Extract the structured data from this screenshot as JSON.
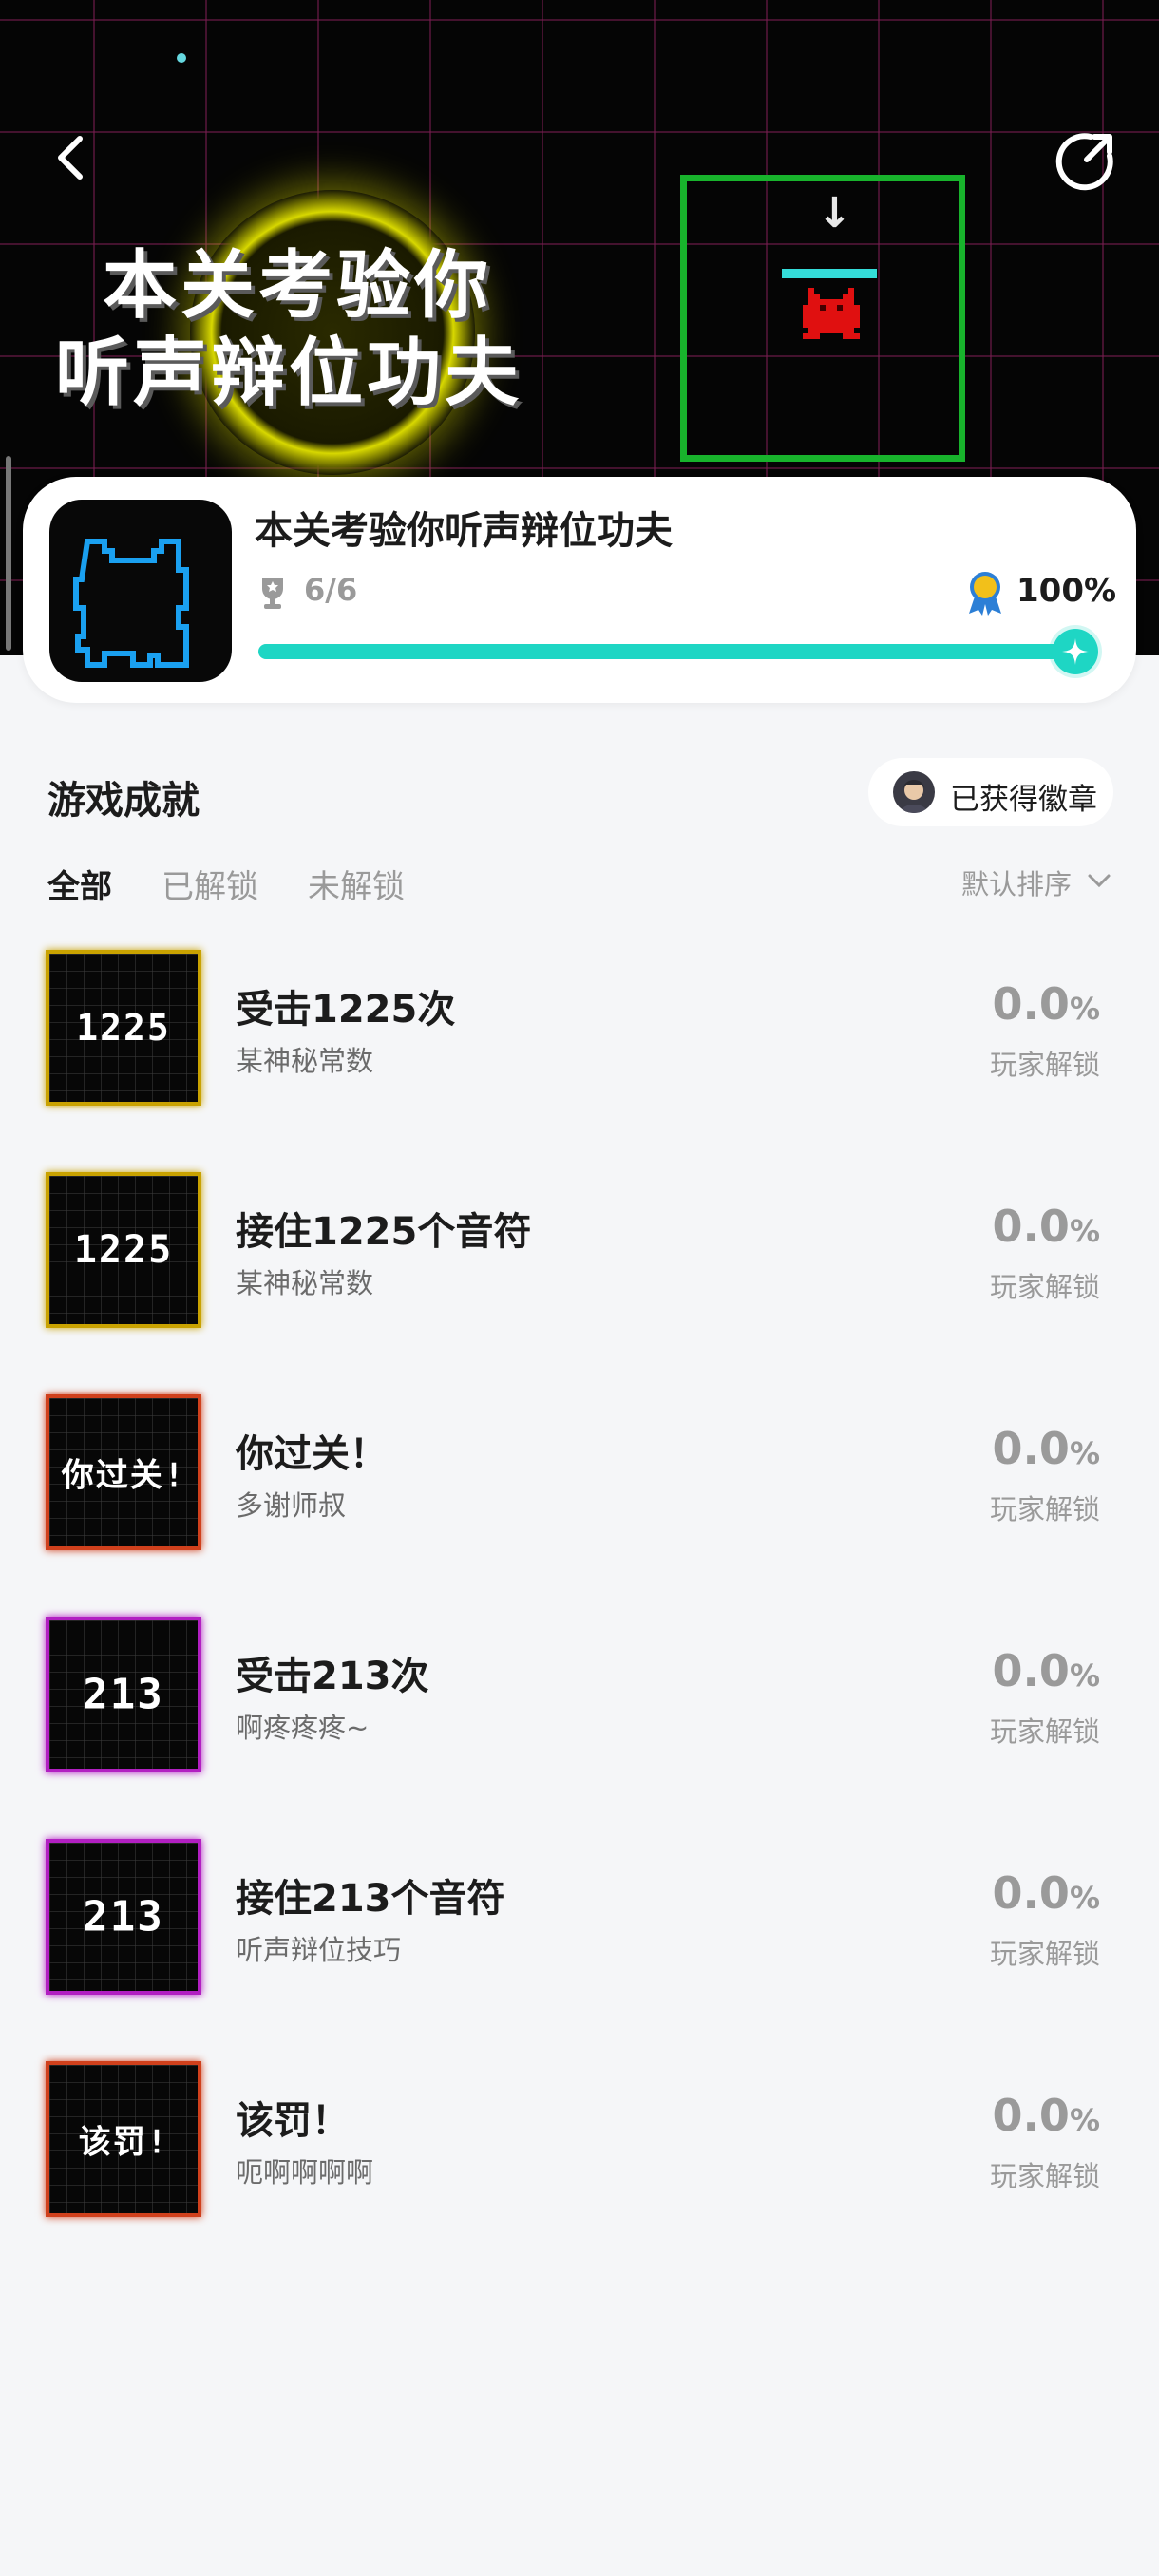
{
  "hero": {
    "title_line1": "本关考验你",
    "title_line2": "听声辩位功夫"
  },
  "game": {
    "name": "本关考验你听声辩位功夫",
    "trophy_count": "6/6",
    "progress_text": "100%",
    "progress": 1.0
  },
  "section": {
    "title": "游戏成就",
    "badge_button": "已获得徽章",
    "tabs": [
      "全部",
      "已解锁",
      "未解锁"
    ],
    "sort_label": "默认排序"
  },
  "achievements": [
    {
      "thumb": "1225",
      "thumb_border": "#c9a200",
      "title": "受击1225次",
      "desc": "某神秘常数",
      "rate": "0.0",
      "pct": "%",
      "unlock": "玩家解锁"
    },
    {
      "thumb": "1225",
      "thumb_border": "#c9a200",
      "title": "接住1225个音符",
      "desc": "某神秘常数",
      "rate": "0.0",
      "pct": "%",
      "unlock": "玩家解锁"
    },
    {
      "thumb": "你过关!",
      "thumb_border": "#d0401c",
      "title": "你过关！",
      "desc": "多谢师叔",
      "rate": "0.0",
      "pct": "%",
      "unlock": "玩家解锁"
    },
    {
      "thumb": "213",
      "thumb_border": "#b21fc2",
      "title": "受击213次",
      "desc": "啊疼疼疼~",
      "rate": "0.0",
      "pct": "%",
      "unlock": "玩家解锁"
    },
    {
      "thumb": "213",
      "thumb_border": "#b21fc2",
      "title": "接住213个音符",
      "desc": "听声辩位技巧",
      "rate": "0.0",
      "pct": "%",
      "unlock": "玩家解锁"
    },
    {
      "thumb": "该罚!",
      "thumb_border": "#d0401c",
      "title": "该罚！",
      "desc": "呃啊啊啊啊",
      "rate": "0.0",
      "pct": "%",
      "unlock": "玩家解锁"
    }
  ],
  "colors": {
    "accent": "#1ed6c4",
    "hero_bg": "#050505",
    "page_bg": "#f5f6f8"
  },
  "icons": [
    "back-icon",
    "share-icon",
    "trophy-icon",
    "medal-icon",
    "sparkle-icon",
    "chevron-down-icon"
  ]
}
